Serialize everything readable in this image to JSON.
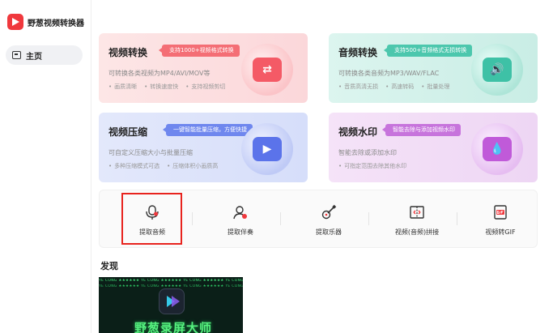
{
  "app": {
    "name": "野葱视频转换器"
  },
  "sidebar": {
    "items": [
      {
        "label": "主页",
        "icon": "home-icon"
      }
    ]
  },
  "cards": [
    {
      "title": "视频转换",
      "tag": "支持1000+视频格式转换",
      "desc": "可转换各类视频为MP4/AVI/MOV等",
      "features": [
        "画质清晰",
        "转换速度快",
        "支持视频剪切"
      ],
      "icon": "video-convert-icon",
      "accent": "#f46e75"
    },
    {
      "title": "音频转换",
      "tag": "支持500+音频格式无损转换",
      "desc": "可转换各类音频为MP3/WAV/FLAC",
      "features": [
        "音质高清无损",
        "高速转码",
        "批量处理"
      ],
      "icon": "audio-convert-icon",
      "accent": "#4cc7ad"
    },
    {
      "title": "视频压缩",
      "tag": "一键智能批量压缩，方便快捷",
      "desc": "可自定义压缩大小与批量压缩",
      "features": [
        "多种压缩模式可选",
        "压缩体积小画质高"
      ],
      "icon": "video-compress-icon",
      "accent": "#6f87ee"
    },
    {
      "title": "视频水印",
      "tag": "智能去除与添加视频水印",
      "desc": "智能去除或添加水印",
      "features": [
        "可指定范围去除其他水印"
      ],
      "icon": "watermark-icon",
      "accent": "#c774dc"
    }
  ],
  "tools": [
    {
      "label": "提取音频",
      "icon": "extract-audio-icon",
      "selected": true
    },
    {
      "label": "提取伴奏",
      "icon": "extract-accompaniment-icon"
    },
    {
      "label": "提取乐器",
      "icon": "guitar-icon"
    },
    {
      "label": "视频(音频)拼接",
      "icon": "video-merge-icon"
    },
    {
      "label": "视频转GIF",
      "icon": "gif-icon"
    }
  ],
  "discover": {
    "title": "发现",
    "banner": {
      "strip_text": "YE CONG ★★★★★★ YE CONG ★★★★★★ YE CONG ★★★★★★ YE CONG ★★★★★★",
      "text": "野葱录屏大师"
    }
  }
}
